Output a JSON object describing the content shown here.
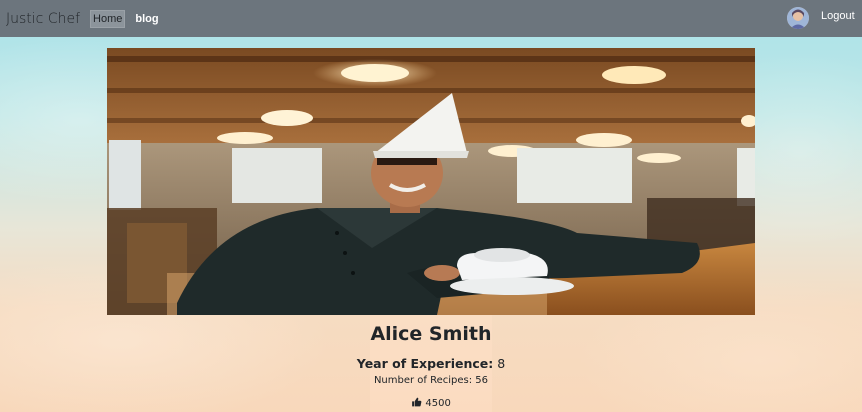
{
  "navbar": {
    "brand": "Justic Chef",
    "links": [
      "Home",
      "blog"
    ],
    "logout_label": "Logout"
  },
  "chef": {
    "name": "Alice Smith",
    "experience_label": "Year of Experience:",
    "experience_value": "8",
    "recipes_text": "Number of Recipes: 56",
    "likes": "4500"
  },
  "colors": {
    "navbar": "#6c757d",
    "text": "#212529"
  }
}
